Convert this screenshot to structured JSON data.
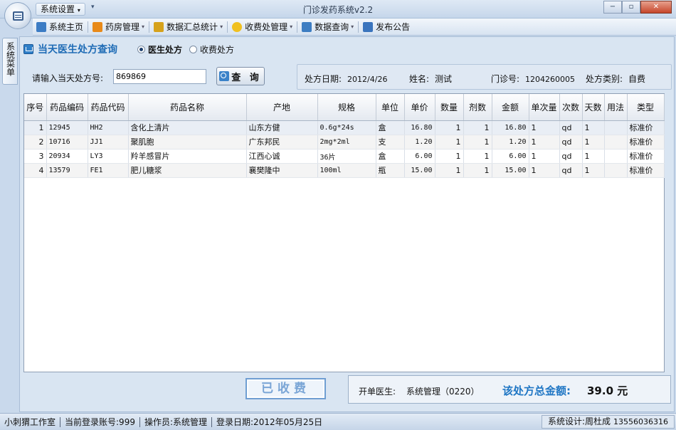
{
  "window": {
    "title": "门诊发药系统v2.2",
    "quick_access_label": "系统设置",
    "minimize": "−",
    "maximize": "▫",
    "close": "✕"
  },
  "menu": {
    "items": [
      {
        "label": "系统主页",
        "icon": "home-icon",
        "dropdown": false,
        "color": "#3c7cc4"
      },
      {
        "label": "药房管理",
        "icon": "rss-icon",
        "dropdown": true,
        "color": "#e88a1a"
      },
      {
        "label": "数据汇总统计",
        "icon": "bar-chart-icon",
        "dropdown": true,
        "color": "#d6a21c"
      },
      {
        "label": "收费处管理",
        "icon": "star-icon",
        "dropdown": true,
        "color": "#f0c020"
      },
      {
        "label": "数据查询",
        "icon": "search-icon",
        "dropdown": true,
        "color": "#3d7dc2"
      },
      {
        "label": "发布公告",
        "icon": "notice-icon",
        "dropdown": false,
        "color": "#3a74bd"
      }
    ]
  },
  "sidebar": {
    "tab_label": "系统菜单"
  },
  "panel": {
    "title": "当天医生处方查询",
    "radio_doctor": "医生处方",
    "radio_fee": "收费处方"
  },
  "query": {
    "label": "请输入当天处方号:",
    "value": "869869",
    "button": "查 询"
  },
  "info": {
    "date_label": "处方日期:",
    "date_value": "2012/4/26",
    "name_label": "姓名:",
    "name_value": "测试",
    "clinic_label": "门诊号:",
    "clinic_value": "1204260005",
    "type_label": "处方类别:",
    "type_value": "自费"
  },
  "table": {
    "headers": [
      "序号",
      "药品编码",
      "药品代码",
      "药品名称",
      "产地",
      "规格",
      "单位",
      "单价",
      "数量",
      "剂数",
      "金额",
      "单次量",
      "次数",
      "天数",
      "用法",
      "类型"
    ],
    "rows": [
      [
        "1",
        "12945",
        "HH2",
        "含化上清片",
        "山东方健",
        "0.6g*24s",
        "盒",
        "16.80",
        "1",
        "1",
        "16.80",
        "1",
        "qd",
        "1",
        "",
        "标准价"
      ],
      [
        "2",
        "10716",
        "JJ1",
        "聚肌胞",
        "广东邦民",
        "2mg*2ml",
        "支",
        "1.20",
        "1",
        "1",
        "1.20",
        "1",
        "qd",
        "1",
        "",
        "标准价"
      ],
      [
        "3",
        "20934",
        "LY3",
        "羚羊感冒片",
        "江西心诚",
        "36片",
        "盒",
        "6.00",
        "1",
        "1",
        "6.00",
        "1",
        "qd",
        "1",
        "",
        "标准价"
      ],
      [
        "4",
        "13579",
        "FE1",
        "肥儿糖浆",
        "襄樊隆中",
        "100ml",
        "瓶",
        "15.00",
        "1",
        "1",
        "15.00",
        "1",
        "qd",
        "1",
        "",
        "标准价"
      ]
    ]
  },
  "footer": {
    "paid_stamp": "已收费",
    "doctor_label": "开单医生:",
    "doctor_value": "系统管理（0220）",
    "total_label": "该处方总金额:",
    "total_value": "39.0 元"
  },
  "status": {
    "studio": "小刺猬工作室",
    "account": "当前登录账号:999",
    "operator": "操作员:系统管理",
    "login_date": "登录日期:2012年05月25日",
    "designer": "系统设计:周杜成",
    "phone": "13556036316"
  },
  "colors": {
    "accent": "#1f6cb6",
    "total_label": "#1f76c4",
    "paid_stamp": "#7aa5d6"
  }
}
